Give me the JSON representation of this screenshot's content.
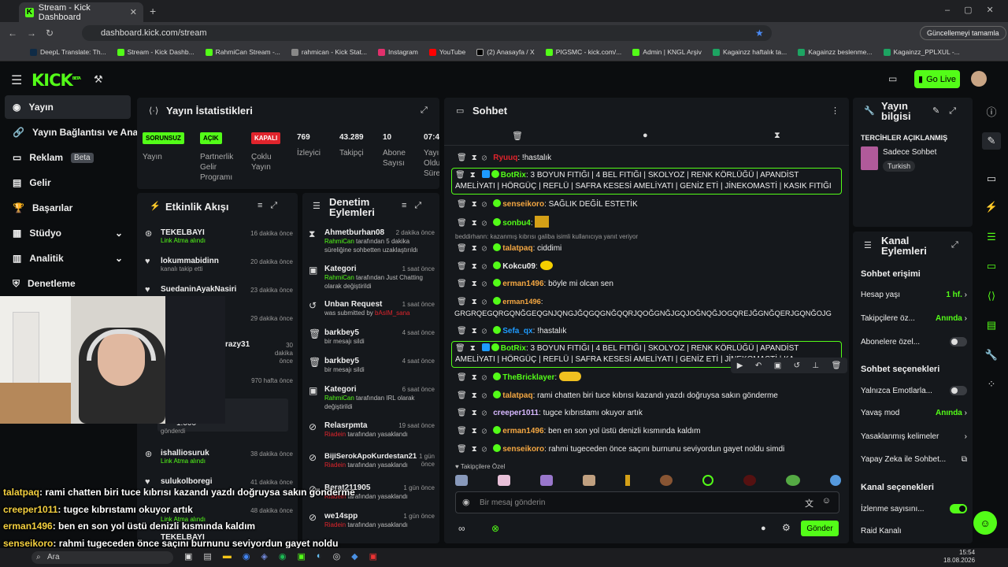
{
  "browser": {
    "tab_title": "Stream - Kick Dashboard",
    "url": "dashboard.kick.com/stream",
    "update_label": "Güncellemeyi tamamla",
    "bookmarks": [
      "DeepL Translate: Th...",
      "Stream - Kick Dashb...",
      "RahmiCan Stream -...",
      "rahmican - Kick Stat...",
      "Instagram",
      "YouTube",
      "(2) Anasayfa / X",
      "PIGSMC - kick.com/...",
      "Admin | KNGL Arşiv",
      "Kagainzz haftalık ta...",
      "Kagainzz beslenme...",
      "Kagainzz_PPLXUL -..."
    ]
  },
  "header": {
    "logo": "KICK",
    "logo_sup": "BETA",
    "go_live": "Go Live"
  },
  "sidebar": {
    "items": [
      {
        "label": "Yayın"
      },
      {
        "label": "Yayın Bağlantısı ve Anahtar"
      },
      {
        "label": "Reklam",
        "badge": "Beta"
      },
      {
        "label": "Gelir"
      },
      {
        "label": "Başarılar"
      },
      {
        "label": "Stüdyo"
      },
      {
        "label": "Analitik"
      },
      {
        "label": "Denetleme"
      }
    ]
  },
  "stats": {
    "title": "Yayın İstatistikleri",
    "items": [
      {
        "badge": "SORUNSUZ",
        "label": "Yayın",
        "color": "#53fc18"
      },
      {
        "badge": "AÇIK",
        "label": "Partnerlik Gelir Programı",
        "color": "#53fc18"
      },
      {
        "badge": "KAPALI",
        "label": "Çoklu Yayın",
        "color": "#e0242c"
      },
      {
        "value": "769",
        "label": "İzleyici"
      },
      {
        "value": "43.289",
        "label": "Takipçi"
      },
      {
        "value": "10",
        "label": "Abone Sayısı"
      },
      {
        "value": "07:45",
        "label": "Yayın Oldu Süre"
      }
    ]
  },
  "activity": {
    "title": "Etkinlik Akışı",
    "items": [
      {
        "name": "TEKELBAYI",
        "sub": "Link Atma alındı",
        "time": "16 dakika önce"
      },
      {
        "name": "lokummabidinn",
        "sub": "kanalı takip etti",
        "time": "20 dakika önce"
      },
      {
        "name": "SuedaninAyakNasiri",
        "sub": "",
        "time": "23 dakika önce"
      },
      {
        "name": "",
        "sub": "",
        "time": "29 dakika önce"
      },
      {
        "name": "razy31",
        "sub": "",
        "time": "30 dakika önce"
      },
      {
        "name": "",
        "sub": "",
        "time": "970 hafta önce"
      },
      {
        "name": "1.000",
        "sub": "gönderdi",
        "time": ""
      },
      {
        "name": "ishalliosuruk",
        "sub": "Link Atma alındı",
        "time": "38 dakika önce"
      },
      {
        "name": "sulukolboregi",
        "sub": "",
        "time": "41 dakika önce"
      },
      {
        "name": "",
        "sub": "Link Atma alındı",
        "time": "48 dakika önce"
      },
      {
        "name": "TEKELBAYI",
        "sub": "",
        "time": ""
      }
    ]
  },
  "moderation": {
    "title": "Denetim Eylemleri",
    "items": [
      {
        "name": "Ahmetburhan08",
        "sub1": "RahmiCan",
        "sub2": " tarafından 5 dakika süreliğine sohbetten uzaklaştırıldı",
        "time": "2 dakika önce",
        "icon": "⧗"
      },
      {
        "name": "Kategori",
        "sub1": "RahmiCan",
        "sub2": " tarafından Just Chatting olarak değiştirildi",
        "time": "1 saat önce",
        "icon": "▣"
      },
      {
        "name": "Unban Request",
        "sub1": "was submitted by ",
        "sub2": "bAsIM_sana",
        "time": "1 saat önce",
        "icon": "↺"
      },
      {
        "name": "barkbey5",
        "sub1": "",
        "sub2": "bir mesajı sildi",
        "time": "4 saat önce",
        "icon": "🗑"
      },
      {
        "name": "barkbey5",
        "sub1": "",
        "sub2": "bir mesajı sildi",
        "time": "4 saat önce",
        "icon": "🗑"
      },
      {
        "name": "Kategori",
        "sub1": "RahmiCan",
        "sub2": " tarafından IRL olarak değiştirildi",
        "time": "6 saat önce",
        "icon": "▣"
      },
      {
        "name": "Relasrpmta",
        "sub1": "Riadein",
        "sub2": " tarafından yasaklandı",
        "time": "19 saat önce",
        "icon": "⊘"
      },
      {
        "name": "BijiSerokApoKurdestan21",
        "sub1": "Riadein",
        "sub2": " tarafından yasaklandı",
        "time": "1 gün önce",
        "icon": "⊘"
      },
      {
        "name": "Berat211905",
        "sub1": "Riadein",
        "sub2": " tarafından yasaklandı",
        "time": "1 gün önce",
        "icon": "⊘"
      },
      {
        "name": "we14spp",
        "sub1": "Riadein",
        "sub2": " tarafından yasaklandı",
        "time": "1 gün önce",
        "icon": "⊘"
      }
    ]
  },
  "chat": {
    "title": "Sohbet",
    "reply_note": "beddirhann: kazanmış kıbrısı galiba isimli kullanıcıya yanıt veriyor",
    "messages": [
      {
        "user": "Ryuuq",
        "color": "#e0242c",
        "text": "!hastalık"
      },
      {
        "user": "BotRix",
        "color": "#53fc18",
        "text": "3 BOYUN FITIĞI | 4 BEL FITIĞI | SKOLYOZ | RENK KÖRLÜĞÜ | APANDİST AMELİYATI | HÖRGÜÇ | REFLÜ | SAFRA KESESİ AMELİYATI | GENİZ ETİ | JİNEKOMASTİ | KASIK FITIĞI"
      },
      {
        "user": "senseikoro",
        "color": "#f4a742",
        "text": "SAĞLIK DEĞİL ESTETİK"
      },
      {
        "user": "sonbu4",
        "color": "#53fc18",
        "text": ""
      },
      {
        "user": "talatpaq",
        "color": "#f4a742",
        "text": "ciddimi"
      },
      {
        "user": "Kokcu09",
        "color": "#eee",
        "text": ""
      },
      {
        "user": "erman1496",
        "color": "#f4a742",
        "text": "böyle mi olcan sen"
      },
      {
        "user": "erman1496",
        "color": "#f4a742",
        "text": "GRGRQEGQRGQNĞGEQGNJQNGJĞQGQGNĞQQRJQOĞGNĞJGQJOĞNQĞJOGQREJĞGNĞQERJGQNĞOJG"
      },
      {
        "user": "Sefa_qx",
        "color": "#1e9bff",
        "text": "!hastalık"
      },
      {
        "user": "BotRix",
        "color": "#53fc18",
        "text": "3 BOYUN FITIĞI | 4 BEL FITIĞI | SKOLYOZ | RENK KÖRLÜĞÜ | APANDİST AMELİYATI | HÖRGÜÇ | REFLÜ | SAFRA KESESİ AMELİYATI | GENİZ ETİ | JİNEKOMASTİ | KA"
      },
      {
        "user": "TheBricklayer",
        "color": "#53fc18",
        "text": ""
      },
      {
        "user": "talatpaq",
        "color": "#f4a742",
        "text": "rami chatten biri tuce kıbrısı kazandı yazdı doğruysa sakın gönderme"
      },
      {
        "user": "creeper1011",
        "color": "#d7b8ff",
        "text": "tugce kıbrıstamı okuyor artık"
      },
      {
        "user": "erman1496",
        "color": "#f4a742",
        "text": "ben en son yol üstü denizli kısmında kaldım"
      },
      {
        "user": "senseikoro",
        "color": "#f4a742",
        "text": "rahmi tugeceden önce saçını burnunu seviyordun gayet noldu simdi"
      }
    ],
    "followers_label": "Takipçilere Özel",
    "input_placeholder": "Bir mesaj gönderin",
    "send_label": "Gönder"
  },
  "stream_info": {
    "title": "Yayın bilgisi",
    "prefs_title": "TERCİHLER AÇIKLANMIŞ",
    "category": "Sadece Sohbet",
    "language": "Turkish"
  },
  "channel_actions": {
    "title": "Kanal Eylemleri",
    "chat_access": "Sohbet erişimi",
    "rows1": [
      {
        "label": "Hesap yaşı",
        "value": "1 hf."
      },
      {
        "label": "Takipçilere öz...",
        "value": "Anında"
      },
      {
        "label": "Abonelere özel...",
        "toggle": false
      }
    ],
    "chat_options": "Sohbet seçenekleri",
    "rows2": [
      {
        "label": "Yalnızca Emotlarla...",
        "toggle": false
      },
      {
        "label": "Yavaş mod",
        "value": "Anında"
      },
      {
        "label": "Yasaklanmış kelimeler",
        "value": ""
      },
      {
        "label": "Yapay Zeka ile Sohbet...",
        "value": ""
      }
    ],
    "channel_options": "Kanal seçenekleri",
    "rows3": [
      {
        "label": "İzlenme sayısını...",
        "toggle": true
      },
      {
        "label": "Raid Kanalı",
        "value": ""
      }
    ]
  },
  "overlay_chat": [
    {
      "user": "talatpaq",
      "text": ": rami chatten biri tuce kıbrısı kazandı yazdı doğruysa sakın gönderme"
    },
    {
      "user": "creeper1011",
      "text": ": tugce kıbrıstamı okuyor artık"
    },
    {
      "user": "erman1496",
      "text": ": ben en son yol üstü denizli kısmında kaldım"
    },
    {
      "user": "senseikoro",
      "text": ": rahmi tugeceden önce saçını burnunu seviyordun gayet noldu"
    }
  ],
  "taskbar": {
    "search": "Ara",
    "time": "15:54",
    "date": "18.08.2026"
  }
}
